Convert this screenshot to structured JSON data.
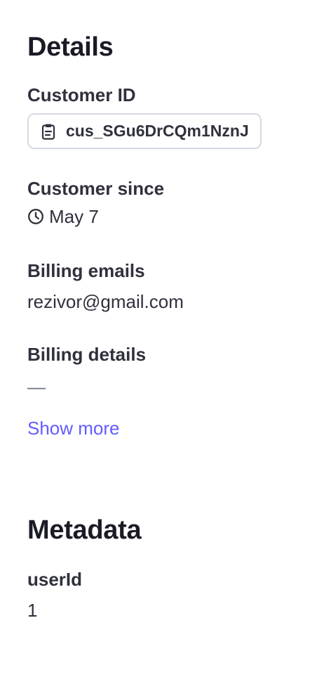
{
  "details": {
    "title": "Details",
    "customer_id": {
      "label": "Customer ID",
      "value": "cus_SGu6DrCQm1NznJ",
      "icon": "clipboard-icon"
    },
    "customer_since": {
      "label": "Customer since",
      "value": "May 7",
      "icon": "clock-icon"
    },
    "billing_emails": {
      "label": "Billing emails",
      "value": "rezivor@gmail.com"
    },
    "billing_details": {
      "label": "Billing details",
      "value": "—"
    },
    "show_more": "Show more"
  },
  "metadata": {
    "title": "Metadata",
    "items": [
      {
        "key": "userId",
        "value": "1"
      }
    ]
  },
  "colors": {
    "text": "#30313d",
    "heading": "#1a1b25",
    "link": "#635bff",
    "border": "#d5dbe1"
  }
}
